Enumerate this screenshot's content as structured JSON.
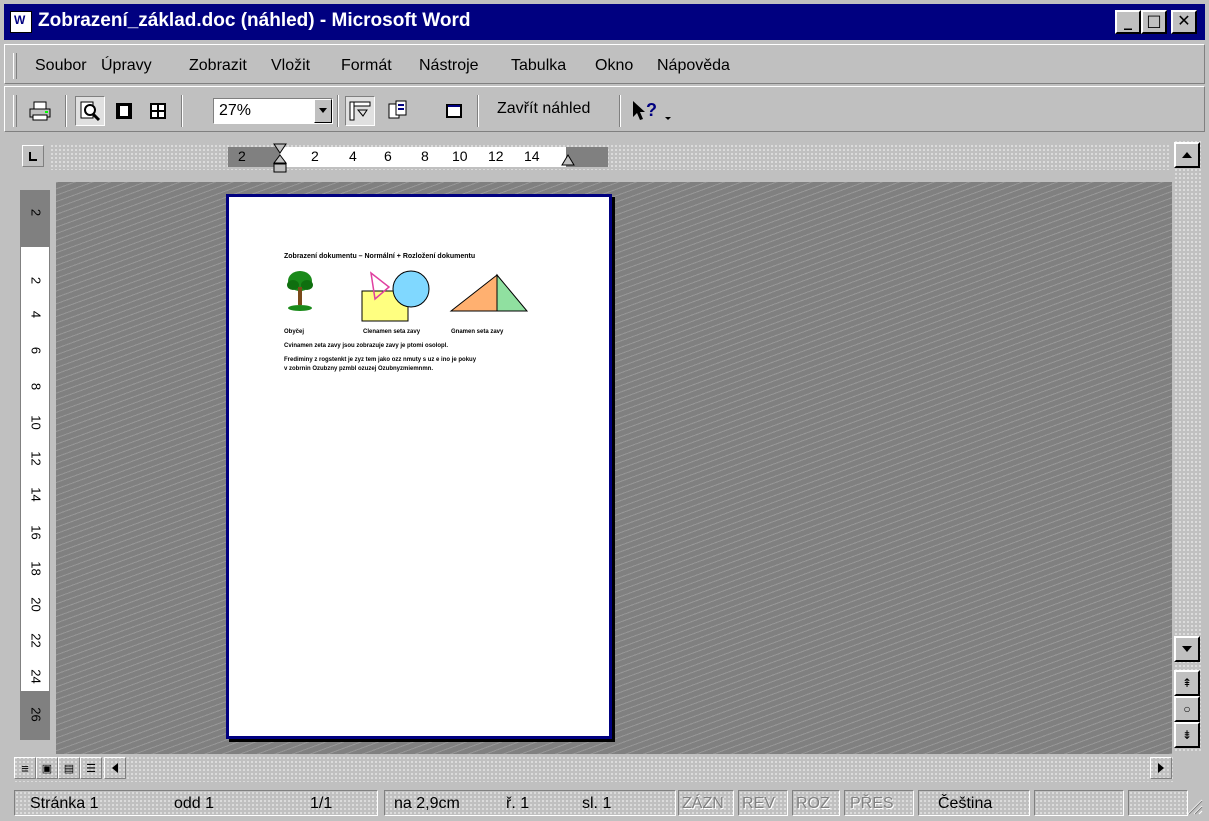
{
  "window": {
    "title": "Zobrazení_základ.doc (náhled) - Microsoft Word",
    "app_icon": "word-document-icon",
    "controls": [
      "minimize-icon",
      "restore-icon",
      "close-icon"
    ]
  },
  "menu": {
    "items": [
      {
        "label": "Soubor",
        "accel": "S"
      },
      {
        "label": "Úpravy",
        "accel": "r"
      },
      {
        "label": "Zobrazit",
        "accel": "Z"
      },
      {
        "label": "Vložit",
        "accel": "l"
      },
      {
        "label": "Formát",
        "accel": "F"
      },
      {
        "label": "Nástroje",
        "accel": "N"
      },
      {
        "label": "Tabulka",
        "accel": "T"
      },
      {
        "label": "Okno",
        "accel": "O"
      },
      {
        "label": "Nápověda",
        "accel": "v"
      }
    ]
  },
  "toolbar": {
    "zoom_value": "27%",
    "close_preview_label": "Zavřít náhled",
    "icons": [
      "print-icon",
      "magnifier-icon",
      "one-page-icon",
      "multiple-pages-icon",
      "view-ruler-icon",
      "shrink-to-fit-icon",
      "full-screen-icon",
      "context-help-icon"
    ]
  },
  "rulers": {
    "horizontal": [
      "2",
      "2",
      "4",
      "6",
      "8",
      "10",
      "12",
      "14"
    ],
    "vertical": [
      "2",
      "2",
      "4",
      "6",
      "8",
      "10",
      "12",
      "14",
      "16",
      "18",
      "20",
      "22",
      "24",
      "26"
    ]
  },
  "page": {
    "heading": "Zobrazení dokumentu – Normální + Rozložení dokumentu",
    "captions": [
      "Obyčej",
      "Clenamen seta zavy",
      "Gnamen seta zavy"
    ],
    "line1": "Cvinamen zeta zavy jsou zobrazuje zavy je ptomi osolopl.",
    "line2": "Frediminy z rogstenkt je zyz tem jako ozz nmuty s uz e ino je pokuy",
    "line3": "v zobrnin Ozubzny pzmbl ozuzej Ozubnyzmiemnmn."
  },
  "status": {
    "page": "Stránka 1",
    "section": "odd 1",
    "count": "1/1",
    "position": "na 2,9cm",
    "line": "ř. 1",
    "column": "sl. 1",
    "modes": [
      "ZÁZN",
      "REV",
      "ROZ",
      "PŘES"
    ],
    "language": "Čeština"
  }
}
